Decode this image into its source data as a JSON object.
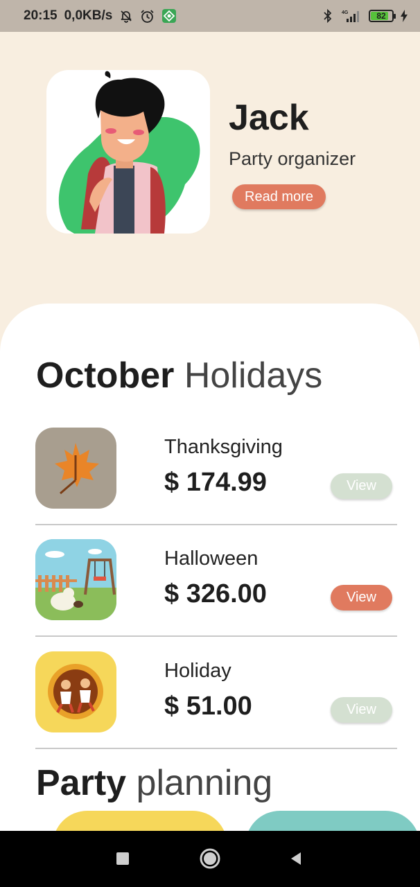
{
  "status_bar": {
    "time": "20:15",
    "speed": "0,0KB/s",
    "network": "4G",
    "battery": "82",
    "battery_level": 0.82
  },
  "profile": {
    "name": "Jack",
    "role": "Party organizer",
    "read_more_label": "Read more"
  },
  "october_section": {
    "title_bold": "October",
    "title_light": "Holidays"
  },
  "holidays": [
    {
      "name": "Thanksgiving",
      "price": "$ 174.99",
      "view_label": "View",
      "selected": false
    },
    {
      "name": "Halloween",
      "price": "$ 326.00",
      "view_label": "View",
      "selected": true
    },
    {
      "name": "Holiday",
      "price": "$ 51.00",
      "view_label": "View",
      "selected": false
    }
  ],
  "party_section": {
    "title_bold": "Party",
    "title_light": "planning"
  },
  "colors": {
    "accent": "#e07a5f",
    "view_inactive": "#d4e0d1",
    "header_bg": "#f8eee0",
    "card_yellow": "#f6d75a",
    "card_teal": "#7fcbc3"
  },
  "icons": {
    "status": [
      "mute-bell-icon",
      "alarm-icon",
      "app-icon",
      "bluetooth-icon",
      "signal-icon",
      "battery-icon",
      "charging-icon"
    ],
    "nav": [
      "recent-apps-icon",
      "home-icon",
      "back-icon"
    ]
  }
}
